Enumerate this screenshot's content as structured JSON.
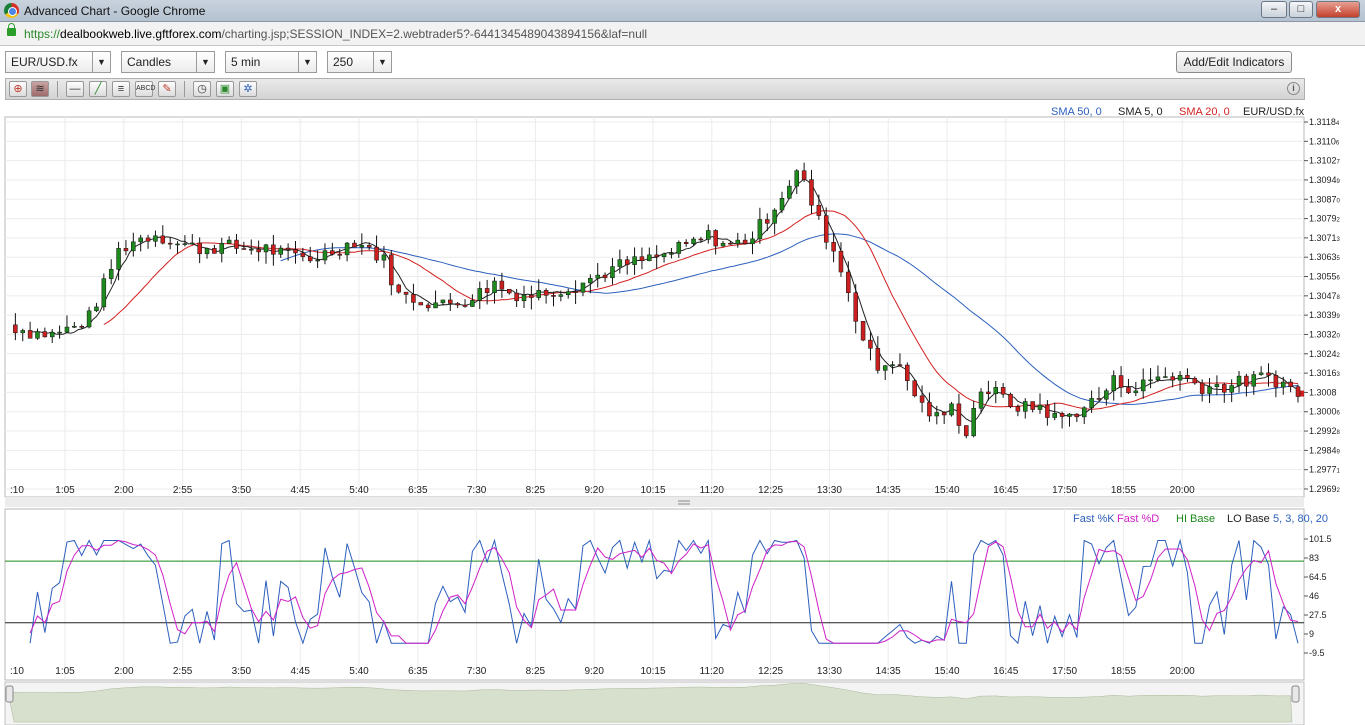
{
  "window": {
    "title": "Advanced Chart - Google Chrome",
    "buttons": {
      "minimize": "–",
      "maximize": "□",
      "close": "x"
    }
  },
  "address": {
    "scheme": "https://",
    "host": "dealbookweb.live.gftforex.com",
    "path": "/charting.jsp;SESSION_INDEX=2.webtrader5?-6441345489043894156&laf=null"
  },
  "controls": {
    "symbol": "EUR/USD.fx",
    "chart_type": "Candles",
    "interval": "5 min",
    "bars": "250",
    "indicators_button": "Add/Edit Indicators"
  },
  "toolbar": {
    "icons": [
      "crosshair-icon",
      "chart-style-icon",
      "horizontal-line-icon",
      "trend-line-icon",
      "fibonacci-icon",
      "abcd-pattern-icon",
      "eraser-icon",
      "clock-icon",
      "export-icon",
      "settings-icon"
    ],
    "info": "i"
  },
  "chart_data": [
    {
      "type": "candlestick",
      "title": "",
      "legend": [
        {
          "name": "SMA 50, 0",
          "color": "#2c5fbd"
        },
        {
          "name": "SMA 5, 0",
          "color": "#222222"
        },
        {
          "name": "SMA 20, 0",
          "color": "#d42020"
        },
        {
          "name": "EUR/USD.fx",
          "color": "#222222"
        }
      ],
      "x_tick_labels": [
        ":10",
        "1:05",
        "2:00",
        "2:55",
        "3:50",
        "4:45",
        "5:40",
        "6:35",
        "7:30",
        "8:25",
        "9:20",
        "10:15",
        "11:20",
        "12:25",
        "13:30",
        "14:35",
        "15:40",
        "16:45",
        "17:50",
        "18:55",
        "20:00"
      ],
      "y_tick_labels": [
        "1.3118",
        "1.3110",
        "1.3102",
        "1.3094",
        "1.3087",
        "1.3079",
        "1.3071",
        "1.3063",
        "1.3055",
        "1.3047",
        "1.3039",
        "1.3032",
        "1.3024",
        "1.3016",
        "1.3008",
        "1.3000",
        "1.2992",
        "1.2984",
        "1.2977",
        "1.2969"
      ],
      "y_tick_small_digits": [
        "4",
        "6",
        "7",
        "9",
        "0",
        "2",
        "3",
        "5",
        "6",
        "8",
        "9",
        "0",
        "2",
        "3",
        "",
        "6",
        "8",
        "9",
        "1",
        "2"
      ],
      "ylim": [
        1.29692,
        1.31184
      ],
      "last_price": "1.3008",
      "colors": {
        "up": "#1e8a1e",
        "down": "#cc1f1f",
        "sma50": "#2c5fbd",
        "sma5": "#222222",
        "sma20": "#d42020"
      },
      "price_path": [
        [
          0,
          1.3036
        ],
        [
          6,
          1.3033
        ],
        [
          12,
          1.3032
        ],
        [
          18,
          1.3035
        ],
        [
          22,
          1.3039
        ],
        [
          26,
          1.3052
        ],
        [
          30,
          1.3066
        ],
        [
          34,
          1.307
        ],
        [
          40,
          1.3073
        ],
        [
          46,
          1.3069
        ],
        [
          52,
          1.3067
        ],
        [
          58,
          1.3068
        ],
        [
          64,
          1.3067
        ],
        [
          70,
          1.3067
        ],
        [
          76,
          1.3064
        ],
        [
          82,
          1.3063
        ],
        [
          88,
          1.3066
        ],
        [
          94,
          1.307
        ],
        [
          98,
          1.3067
        ],
        [
          102,
          1.3062
        ],
        [
          106,
          1.3048
        ],
        [
          112,
          1.3046
        ],
        [
          118,
          1.3044
        ],
        [
          124,
          1.3046
        ],
        [
          128,
          1.3049
        ],
        [
          132,
          1.3053
        ],
        [
          136,
          1.3049
        ],
        [
          142,
          1.3048
        ],
        [
          148,
          1.305
        ],
        [
          154,
          1.3052
        ],
        [
          160,
          1.3056
        ],
        [
          166,
          1.306
        ],
        [
          172,
          1.3062
        ],
        [
          178,
          1.3064
        ],
        [
          184,
          1.3068
        ],
        [
          190,
          1.3072
        ],
        [
          196,
          1.3068
        ],
        [
          202,
          1.3072
        ],
        [
          206,
          1.308
        ],
        [
          210,
          1.3089
        ],
        [
          214,
          1.3098
        ],
        [
          216,
          1.3093
        ],
        [
          220,
          1.3078
        ],
        [
          224,
          1.3066
        ],
        [
          228,
          1.305
        ],
        [
          232,
          1.303
        ],
        [
          236,
          1.3018
        ],
        [
          240,
          1.3022
        ],
        [
          244,
          1.3013
        ],
        [
          248,
          1.3003
        ],
        [
          252,
          1.2998
        ],
        [
          256,
          1.3002
        ],
        [
          260,
          1.2993
        ],
        [
          264,
          1.301
        ],
        [
          268,
          1.3008
        ],
        [
          272,
          1.3004
        ],
        [
          276,
          1.3002
        ],
        [
          280,
          1.3003
        ],
        [
          284,
          1.2998
        ],
        [
          288,
          1.2999
        ],
        [
          292,
          1.3003
        ],
        [
          296,
          1.3006
        ],
        [
          300,
          1.3013
        ],
        [
          306,
          1.301
        ],
        [
          312,
          1.3015
        ],
        [
          318,
          1.3015
        ],
        [
          324,
          1.3011
        ],
        [
          330,
          1.3011
        ],
        [
          336,
          1.3013
        ],
        [
          342,
          1.3015
        ],
        [
          346,
          1.3012
        ],
        [
          350,
          1.3008
        ]
      ]
    },
    {
      "type": "line",
      "title": "",
      "legend": [
        {
          "name": "Fast %K",
          "color": "#2c5fbd"
        },
        {
          "name": "Fast %D",
          "color": "#d020c8"
        },
        {
          "name": "HI Base",
          "color": "#1a8a1a"
        },
        {
          "name": "LO Base",
          "color": "#222222"
        },
        {
          "name": "5, 3, 80, 20",
          "color": "#2c5fbd"
        }
      ],
      "x_tick_labels": [
        ":10",
        "1:05",
        "2:00",
        "2:55",
        "3:50",
        "4:45",
        "5:40",
        "6:35",
        "7:30",
        "8:25",
        "9:20",
        "10:15",
        "11:20",
        "12:25",
        "13:30",
        "14:35",
        "15:40",
        "16:45",
        "17:50",
        "18:55",
        "20:00"
      ],
      "y_tick_labels": [
        "101.5",
        "83",
        "64.5",
        "46",
        "27.5",
        "9",
        "-9.5"
      ],
      "ylim": [
        -9.5,
        101.5
      ],
      "hi_base": 80,
      "lo_base": 20
    }
  ],
  "navigator": {
    "type": "area"
  }
}
